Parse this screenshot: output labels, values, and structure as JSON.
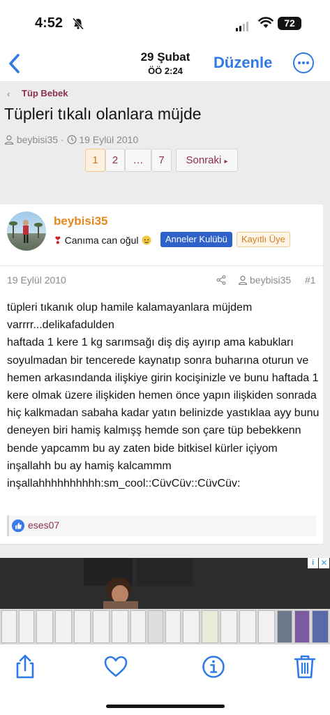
{
  "status_bar": {
    "time": "4:52",
    "battery": "72"
  },
  "photo_nav": {
    "date": "29 Şubat",
    "time": "ÖÖ 2:24",
    "edit_label": "Düzenle"
  },
  "forum": {
    "breadcrumb": "Tüp Bebek",
    "thread_title": "Tüpleri tıkalı olanlara müjde",
    "thread_author": "beybisi35",
    "thread_date": "19 Eylül 2010",
    "separator": "·",
    "pagination": {
      "pages": [
        "1",
        "2",
        "…",
        "7"
      ],
      "active": "1",
      "next_label": "Sonraki"
    }
  },
  "post": {
    "username": "beybisi35",
    "user_title": "Canıma can oğul",
    "badges": [
      "Anneler Kulübü",
      "Kayıtlı Üye"
    ],
    "date": "19 Eylül 2010",
    "author": "beybisi35",
    "number": "#1",
    "body": "tüpleri tıkanık olup hamile kalamayanlara müjdem varrrr...delikafadulden\nhaftada 1 kere 1 kg sarımsağı diş diş ayırıp ama kabukları soyulmadan bir tencerede kaynatıp sonra buharına oturun ve hemen arkasındanda ilişkiye girin kocişinizle ve bunu haftada 1 kere olmak üzere ilişkiden hemen önce yapın ilişkiden sonrada hiç kalkmadan sabaha kadar yatın belinizde yastıklaa ayy bunu deneyen biri hamiş kalmışş hemde son çare tüp bebekkenn bende yapcamm bu ay zaten bide bitkisel kürler içiyom inşallahh bu ay hamiş kalcammm inşallahhhhhhhhhh:sm_cool::CüvCüv::CüvCüv:",
    "reaction_user": "eses07"
  },
  "ad": {
    "info_label": "i",
    "close_label": "✕"
  },
  "colors": {
    "accent_blue": "#2f7ae5",
    "forum_link": "#8c2f50",
    "username": "#e5861f"
  },
  "icons": [
    "bell-slash-icon",
    "signal-icon",
    "wifi-icon",
    "back-chevron-icon",
    "more-icon",
    "share-icon",
    "heart-icon",
    "info-icon",
    "trash-icon"
  ]
}
